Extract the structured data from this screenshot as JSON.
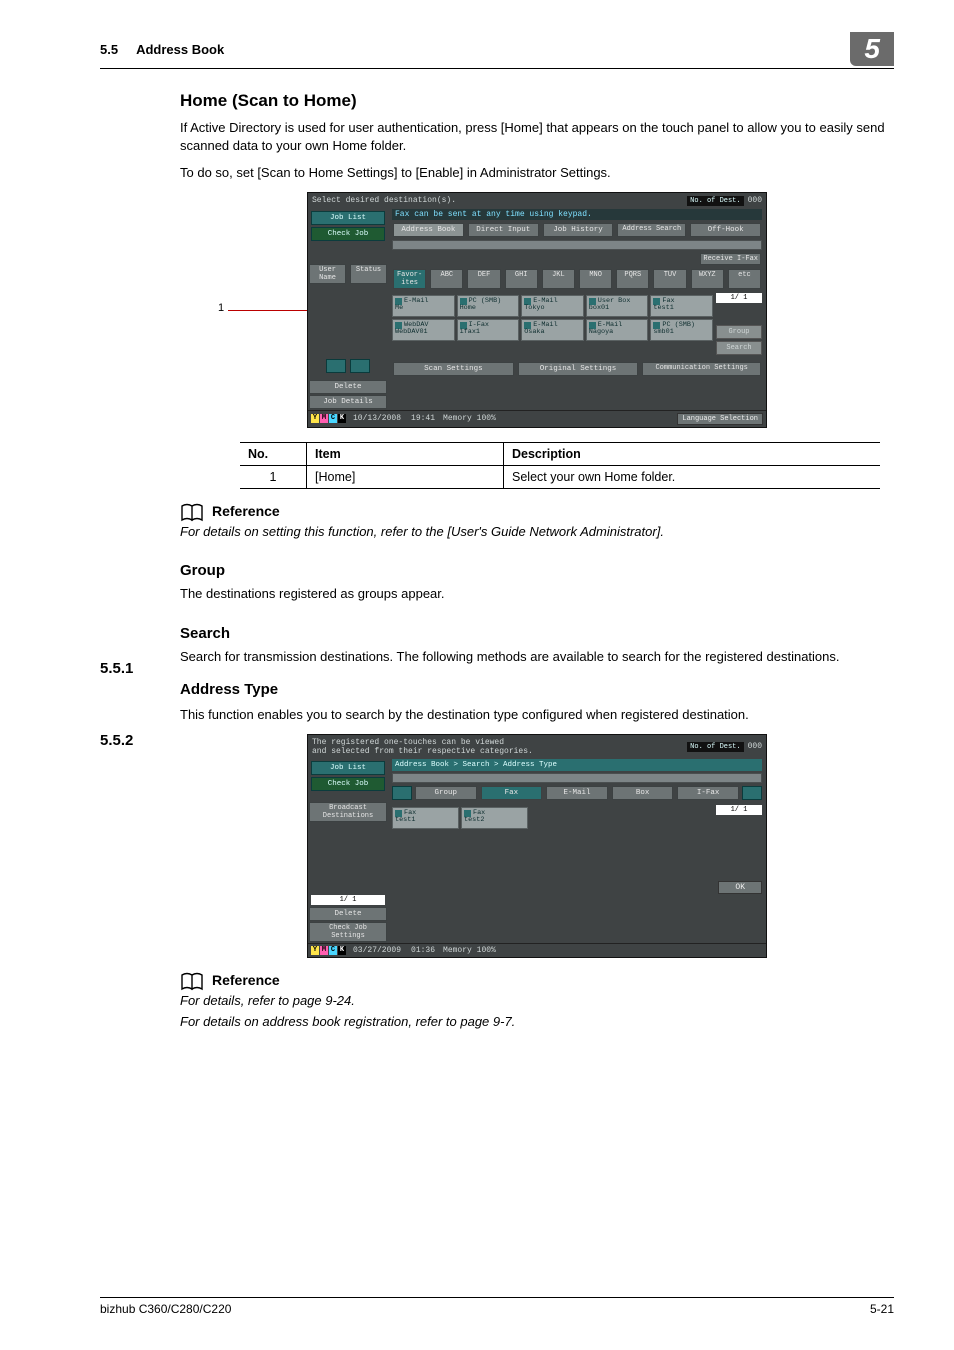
{
  "header": {
    "section_no": "5.5",
    "section_title": "Address Book",
    "chapter_tab": "5"
  },
  "h_home": {
    "title": "Home (Scan to Home)",
    "p1": "If Active Directory is used for user authentication, press [Home] that appears on the touch panel to allow you to easily send scanned data to your own Home folder.",
    "p2": "To do so, set [Scan to Home Settings] to [Enable] in Administrator Settings."
  },
  "callout1": "1",
  "shot1": {
    "msg": "Select desired destination(s).",
    "note": "Fax can be sent at any time using keypad.",
    "dest_lbl": "No. of\nDest.",
    "dest_val": "000",
    "left_tabs": [
      "Job List",
      "Check Job"
    ],
    "left_small": [
      "User\nName",
      "Status"
    ],
    "top_tabs": [
      "Address Book",
      "Direct Input",
      "Job History",
      "Address\nSearch",
      "Off-Hook"
    ],
    "recv": "Receive\nI-Fax",
    "idx": [
      "Favor-\nites",
      "ABC",
      "DEF",
      "GHI",
      "JKL",
      "MNO",
      "PQRS",
      "TUV",
      "WXYZ",
      "etc"
    ],
    "tiles1": [
      [
        "E-Mail",
        "Me"
      ],
      [
        "PC (SMB)",
        "Home"
      ],
      [
        "E-Mail",
        "Tokyo"
      ],
      [
        "User Box",
        "box01"
      ],
      [
        "Fax",
        "test1"
      ]
    ],
    "tiles2": [
      [
        "WebDAV",
        "WebDAV01"
      ],
      [
        "I-Fax",
        "ifax1"
      ],
      [
        "E-Mail",
        "Osaka"
      ],
      [
        "E-Mail",
        "Nagoya"
      ],
      [
        "PC (SMB)",
        "smb01"
      ]
    ],
    "page": "1/ 1",
    "side_btns": [
      "Group",
      "Search"
    ],
    "left_bottom": [
      "Delete",
      "Job Details"
    ],
    "bottom_btns": [
      "Scan Settings",
      "Original Settings",
      "Communication\nSettings"
    ],
    "dt": "10/13/2008",
    "tm": "19:41",
    "mem_l": "Memory",
    "mem_v": "100%",
    "lang": "Language Selection"
  },
  "table1": {
    "head": [
      "No.",
      "Item",
      "Description"
    ],
    "row": [
      "1",
      "[Home]",
      "Select your own Home folder."
    ]
  },
  "ref1": {
    "title": "Reference",
    "text": "For details on setting this function, refer to the [User's Guide Network Administrator]."
  },
  "s551": {
    "no": "5.5.1",
    "title": "Group",
    "p": "The destinations registered as groups appear."
  },
  "s552": {
    "no": "5.5.2",
    "title": "Search",
    "p": "Search for transmission destinations. The following methods are available to search for the registered destinations."
  },
  "addr_type": {
    "title": "Address Type",
    "p": "This function enables you to search by the destination type configured when registered destination."
  },
  "shot2": {
    "msg1": "The registered one-touches can be viewed",
    "msg2": "and selected from their respective categories.",
    "dest_lbl": "No. of\nDest.",
    "dest_val": "000",
    "left_tabs": [
      "Job List",
      "Check Job"
    ],
    "left_lbl": "Broadcast\nDestinations",
    "crumb": "Address Book > Search > Address Type",
    "cats": [
      "Group",
      "Fax",
      "E-Mail",
      "Box",
      "I-Fax"
    ],
    "tiles": [
      [
        "Fax",
        "test1"
      ],
      [
        "Fax",
        "test2"
      ]
    ],
    "page_top": "1/ 1",
    "left_page": "1/ 1",
    "left_bottom": [
      "Delete",
      "Check Job\nSettings"
    ],
    "ok": "OK",
    "dt": "03/27/2009",
    "tm": "01:36",
    "mem_l": "Memory",
    "mem_v": "100%"
  },
  "ref2": {
    "title": "Reference",
    "l1": "For details, refer to page 9-24.",
    "l2": "For details on address book registration, refer to page 9-7."
  },
  "footer": {
    "model": "bizhub C360/C280/C220",
    "page": "5-21"
  }
}
